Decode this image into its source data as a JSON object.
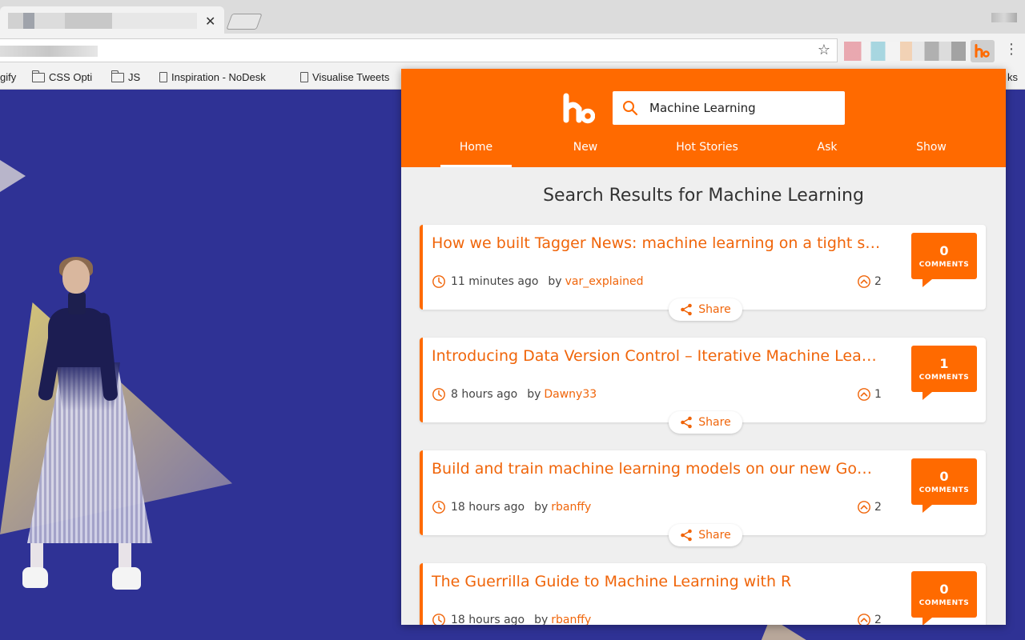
{
  "browser": {
    "bookmarks": [
      {
        "label": "gify",
        "icon": "none"
      },
      {
        "label": "CSS Opti",
        "icon": "folder-icon"
      },
      {
        "label": "JS",
        "icon": "folder-icon"
      },
      {
        "label": "Inspiration - NoDesk",
        "icon": "page-icon"
      },
      {
        "label": "Visualise Tweets",
        "icon": "page-icon"
      },
      {
        "label": "ks",
        "icon": "none"
      }
    ]
  },
  "popup": {
    "search": {
      "value": "Machine Learning"
    },
    "nav": [
      "Home",
      "New",
      "Hot Stories",
      "Ask",
      "Show"
    ],
    "active_nav": "Home",
    "results_title": "Search Results for Machine Learning",
    "share_label": "Share",
    "by_label": "by",
    "comments_label": "COMMENTS",
    "colors": {
      "accent": "#ff6a00",
      "link": "#f0650a",
      "background": "#efefef"
    },
    "results": [
      {
        "title": "How we built Tagger News: machine learning on a tight s…",
        "time": "11 minutes ago",
        "author": "var_explained",
        "points": "2",
        "comments": "0"
      },
      {
        "title": "Introducing Data Version Control – Iterative Machine Lea…",
        "time": "8 hours ago",
        "author": "Dawny33",
        "points": "1",
        "comments": "1"
      },
      {
        "title": "Build and train machine learning models on our new Go…",
        "time": "18 hours ago",
        "author": "rbanffy",
        "points": "2",
        "comments": "0"
      },
      {
        "title": "The Guerrilla Guide to Machine Learning with R",
        "time": "18 hours ago",
        "author": "rbanffy",
        "points": "2",
        "comments": "0"
      }
    ]
  }
}
